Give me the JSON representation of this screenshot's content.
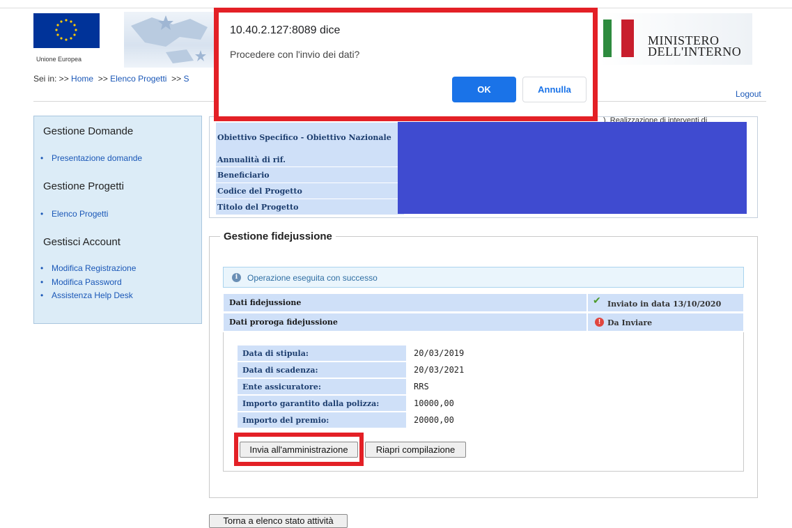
{
  "header": {
    "eu_label": "Unione Europea",
    "ministry_line1": "MINISTERO",
    "ministry_line2": "DELL'INTERNO"
  },
  "breadcrumb": {
    "prefix": "Sei in: >>",
    "home": "Home",
    "sep1": ">>",
    "projects": "Elenco Progetti",
    "sep2": ">>",
    "tail": "S"
  },
  "logout": "Logout",
  "sidebar": {
    "section1_title": "Gestione Domande",
    "section1_items": [
      "Presentazione domande"
    ],
    "section2_title": "Gestione Progetti",
    "section2_items": [
      "Elenco Progetti"
    ],
    "section3_title": "Gestisci Account",
    "section3_items": [
      "Modifica Registrazione",
      "Modifica Password",
      "Assistenza Help Desk"
    ]
  },
  "project_info": {
    "labels": [
      "Obiettivo Specifico - Obiettivo Nazionale",
      "Annualità di rif.",
      "Beneficiario",
      "Codice del Progetto",
      "Titolo del Progetto"
    ],
    "overflow_text": "). Realizzazione di interventi di"
  },
  "fidejussione": {
    "legend": "Gestione fidejussione",
    "success_message": "Operazione eseguita con successo",
    "rows": [
      {
        "label": "Dati fidejussione",
        "status": "Inviato in data 13/10/2020"
      },
      {
        "label": "Dati proroga fidejussione",
        "status": "Da Inviare"
      }
    ],
    "details": [
      {
        "label": "Data di stipula:",
        "value": "20/03/2019"
      },
      {
        "label": "Data di scadenza:",
        "value": "20/03/2021"
      },
      {
        "label": "Ente assicuratore:",
        "value": "RRS"
      },
      {
        "label": "Importo garantito dalla polizza:",
        "value": "10000,00"
      },
      {
        "label": "Importo del premio:",
        "value": "20000,00"
      }
    ],
    "send_button": "Invia all'amministrazione",
    "reopen_button": "Riapri compilazione"
  },
  "back_button": "Torna a elenco stato attività",
  "dialog": {
    "origin": "10.40.2.127:8089 dice",
    "message": "Procedere con l'invio dei dati?",
    "ok": "OK",
    "cancel": "Annulla"
  },
  "colors": {
    "highlight": "#e32026",
    "redacted": "#3f4bd0",
    "table_header": "#cfe0f8",
    "sidebar_bg": "#dcecf7",
    "dialog_ok": "#1a73e8"
  }
}
